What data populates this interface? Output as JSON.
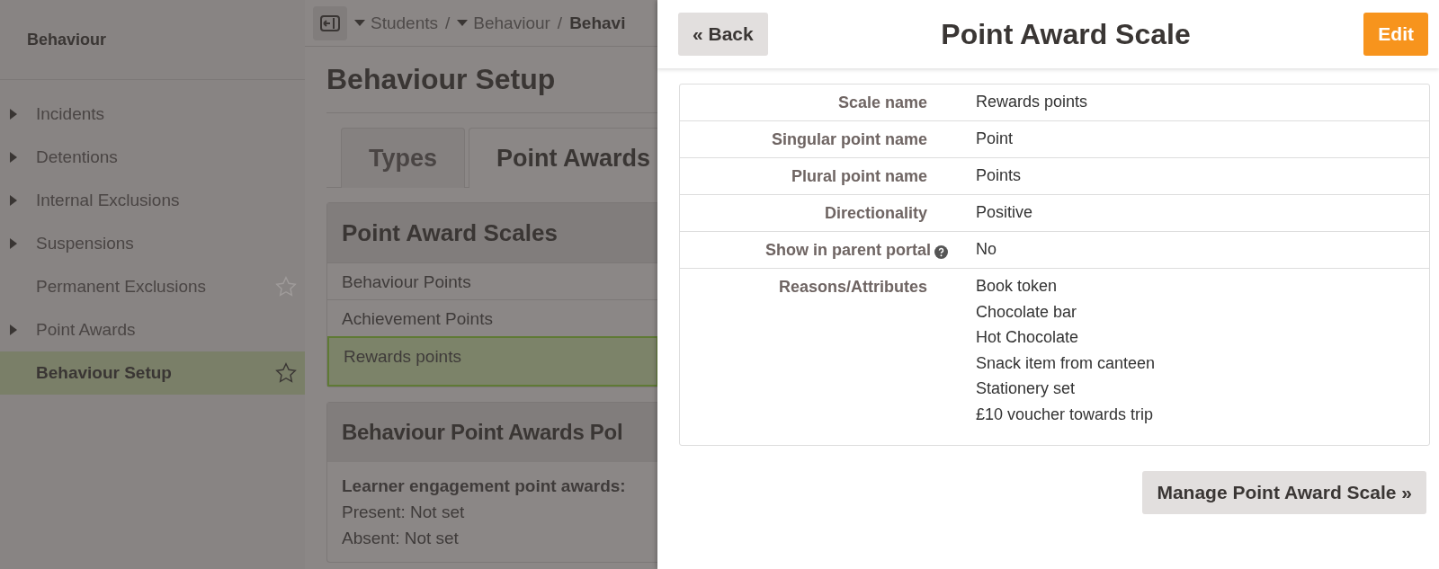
{
  "sidebar": {
    "title": "Behaviour",
    "items": [
      {
        "label": "Incidents",
        "expandable": true,
        "star": false,
        "selected": false
      },
      {
        "label": "Detentions",
        "expandable": true,
        "star": false,
        "selected": false
      },
      {
        "label": "Internal Exclusions",
        "expandable": true,
        "star": false,
        "selected": false
      },
      {
        "label": "Suspensions",
        "expandable": true,
        "star": false,
        "selected": false
      },
      {
        "label": "Permanent Exclusions",
        "expandable": false,
        "star": true,
        "selected": false
      },
      {
        "label": "Point Awards",
        "expandable": true,
        "star": false,
        "selected": false
      },
      {
        "label": "Behaviour Setup",
        "expandable": false,
        "star": true,
        "selected": true
      }
    ]
  },
  "breadcrumb": [
    {
      "label": "Students",
      "separator": "/"
    },
    {
      "label": "Behaviour",
      "separator": "/"
    },
    {
      "label": "Behavi"
    }
  ],
  "page": {
    "title": "Behaviour Setup",
    "tabs": [
      {
        "label": "Types",
        "selected": false
      },
      {
        "label": "Point Awards",
        "selected": true
      }
    ],
    "scales_card": {
      "title": "Point Award Scales",
      "rows": [
        {
          "label": "Behaviour Points",
          "selected": false
        },
        {
          "label": "Achievement Points",
          "selected": false
        },
        {
          "label": "Rewards points",
          "selected": true
        }
      ]
    },
    "policy_card": {
      "title": "Behaviour Point Awards Pol",
      "heading": "Learner engagement point awards:",
      "lines": [
        "Present: Not set",
        "Absent: Not set"
      ]
    }
  },
  "panel": {
    "back": "« Back",
    "title": "Point Award Scale",
    "edit": "Edit",
    "fields": [
      {
        "label": "Scale name",
        "values": [
          "Rewards points"
        ]
      },
      {
        "label": "Singular point name",
        "values": [
          "Point"
        ]
      },
      {
        "label": "Plural point name",
        "values": [
          "Points"
        ]
      },
      {
        "label": "Directionality",
        "values": [
          "Positive"
        ]
      },
      {
        "label": "Show in parent portal",
        "help": true,
        "values": [
          "No"
        ]
      },
      {
        "label": "Reasons/Attributes",
        "values": [
          "Book token",
          "Chocolate bar",
          "Hot Chocolate",
          "Snack item from canteen",
          "Stationery set",
          "£10 voucher towards trip"
        ]
      }
    ],
    "manage": "Manage Point Award Scale »"
  }
}
